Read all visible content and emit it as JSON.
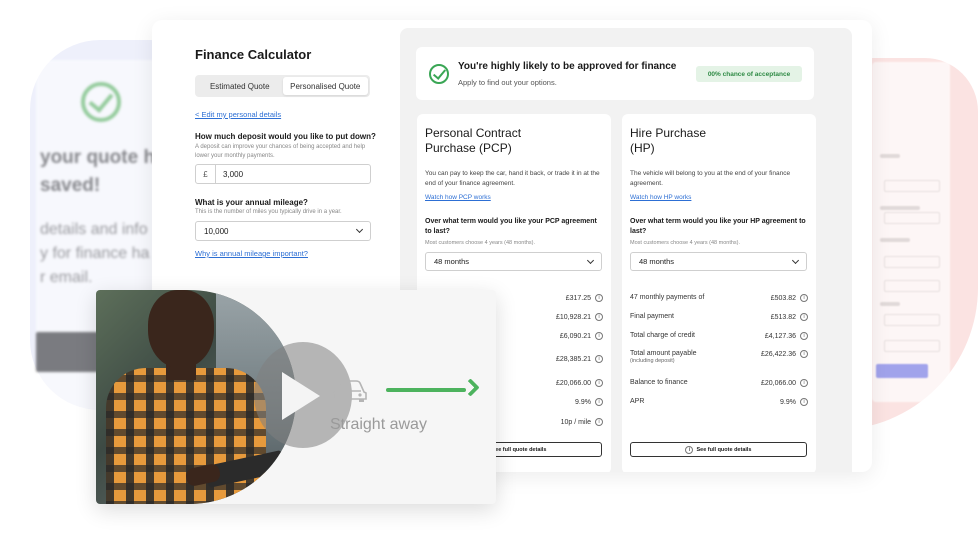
{
  "ghost_left": {
    "title": "your quote h\nsaved!",
    "text": "details and info\ny for finance ha\nr email."
  },
  "calculator": {
    "title": "Finance Calculator",
    "tabs": [
      {
        "label": "Estimated Quote",
        "active": false
      },
      {
        "label": "Personalised Quote",
        "active": true
      }
    ],
    "edit_link": "< Edit my personal details",
    "deposit": {
      "question": "How much deposit would you like to put down?",
      "hint": "A deposit can improve your chances of being accepted and help lower your monthly payments.",
      "prefix": "£",
      "value": "3,000"
    },
    "mileage": {
      "question": "What is your annual mileage?",
      "hint": "This is the number of miles you typically drive in a year.",
      "value": "10,000"
    },
    "why_link": "Why is annual mileage important?"
  },
  "approval": {
    "title": "You're highly likely to be approved for finance",
    "subtitle": "Apply to find out your options.",
    "badge": "00% chance of acceptance",
    "accent": "#3aa655"
  },
  "plans": {
    "pcp": {
      "title": "Personal Contract\nPurchase (PCP)",
      "description": "You can pay to keep the car, hand it back, or trade it in at the end of your finance agreement.",
      "link": "Watch how PCP works",
      "term_question": "Over what term would you like your PCP agreement to last?",
      "term_hint": "Most customers choose 4 years (48 months).",
      "term_value": "48 months",
      "rows": [
        {
          "label": "",
          "value": "£317.25"
        },
        {
          "label": "",
          "value": "£10,928.21"
        },
        {
          "label": "",
          "value": "£6,090.21"
        },
        {
          "label": "",
          "value": "£28,385.21"
        },
        {
          "label": "",
          "value": "£20,066.00"
        },
        {
          "label": "",
          "value": "9.9%"
        },
        {
          "label": "",
          "value": "10p / mile"
        }
      ],
      "full_details": "See full quote details"
    },
    "hp": {
      "title": "Hire Purchase\n(HP)",
      "description": "The vehicle will belong to you at the end of your finance agreement.",
      "link": "Watch how HP works",
      "term_question": "Over what term would you like your HP agreement to last?",
      "term_hint": "Most customers choose 4 years (48 months).",
      "term_value": "48 months",
      "rows": [
        {
          "label": "47 monthly payments of",
          "value": "£503.82"
        },
        {
          "label": "Final payment",
          "value": "£513.82"
        },
        {
          "label": "Total charge of credit",
          "value": "£4,127.36"
        },
        {
          "label": "Total amount payable",
          "note": "(including deposit)",
          "value": "£26,422.36"
        },
        {
          "label": "Balance to finance",
          "value": "£20,066.00"
        },
        {
          "label": "APR",
          "value": "9.9%"
        }
      ],
      "full_details": "See full quote details"
    }
  },
  "video": {
    "caption": "Straight away",
    "play_icon": "play-icon",
    "car_icon": "car-icon",
    "arrow_color": "#4db35e"
  }
}
